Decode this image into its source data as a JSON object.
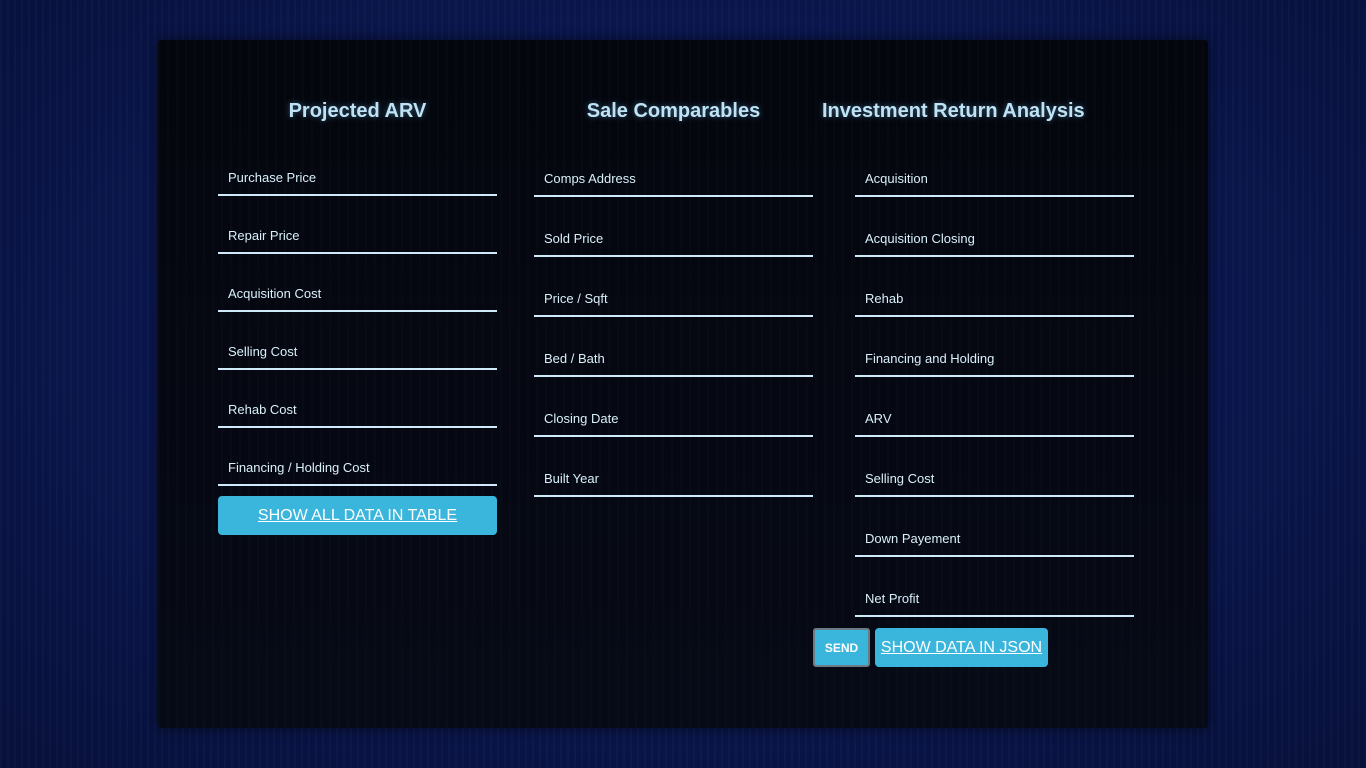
{
  "arv": {
    "title": "Projected ARV",
    "fields": [
      {
        "placeholder": "Purchase Price"
      },
      {
        "placeholder": "Repair Price"
      },
      {
        "placeholder": "Acquisition Cost"
      },
      {
        "placeholder": "Selling Cost"
      },
      {
        "placeholder": "Rehab Cost"
      },
      {
        "placeholder": "Financing / Holding Cost"
      }
    ],
    "show_table_label": "SHOW ALL DATA IN TABLE"
  },
  "comps": {
    "title": "Sale Comparables",
    "fields": [
      {
        "placeholder": "Comps Address"
      },
      {
        "placeholder": "Sold Price"
      },
      {
        "placeholder": "Price / Sqft"
      },
      {
        "placeholder": "Bed / Bath"
      },
      {
        "placeholder": "Closing Date"
      },
      {
        "placeholder": "Built Year"
      }
    ]
  },
  "investment": {
    "title": "Investment Return Analysis",
    "fields": [
      {
        "placeholder": "Acquisition"
      },
      {
        "placeholder": "Acquisition Closing"
      },
      {
        "placeholder": "Rehab"
      },
      {
        "placeholder": "Financing and Holding"
      },
      {
        "placeholder": "ARV"
      },
      {
        "placeholder": "Selling Cost"
      },
      {
        "placeholder": "Down Payement"
      },
      {
        "placeholder": "Net Profit"
      }
    ],
    "send_label": "SEND",
    "show_json_label": "SHOW DATA IN JSON"
  },
  "colors": {
    "accent": "#3ab5dc",
    "title_text": "#bfe3f5",
    "field_underline": "#cfeaf8",
    "panel_bg": "#05080f",
    "page_bg": "#0b1852"
  }
}
